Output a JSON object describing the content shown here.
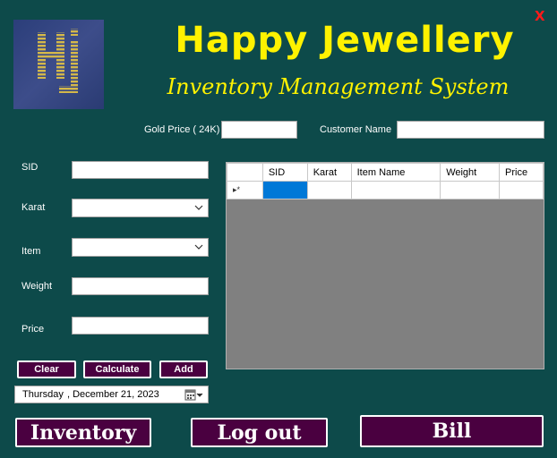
{
  "window": {
    "close_label": "X"
  },
  "header": {
    "title": "Happy Jewellery",
    "subtitle": "Inventory Management System",
    "logo_text": "Hj"
  },
  "top_fields": {
    "gold_price_label": "Gold Price ( 24K)",
    "gold_price_value": "",
    "customer_name_label": "Customer Name",
    "customer_name_value": ""
  },
  "form": {
    "sid_label": "SID",
    "sid_value": "",
    "karat_label": "Karat",
    "karat_value": "",
    "item_label": "Item",
    "item_value": "",
    "weight_label": "Weight",
    "weight_value": "",
    "price_label": "Price",
    "price_value": ""
  },
  "actions": {
    "clear_label": "Clear",
    "calculate_label": "Calculate",
    "add_label": "Add"
  },
  "date_picker": {
    "day": "Thursday",
    "date": ", December 21, 2023"
  },
  "grid": {
    "columns": [
      "SID",
      "Karat",
      "Item Name",
      "Weight",
      "Price"
    ],
    "new_row_indicator": "▸*"
  },
  "footer": {
    "inventory_label": "Inventory",
    "logout_label": "Log out",
    "bill_label": "Bill"
  },
  "colors": {
    "background": "#0d4a4a",
    "title": "#fff200",
    "button": "#4a0040",
    "close": "#ff1a1a"
  }
}
